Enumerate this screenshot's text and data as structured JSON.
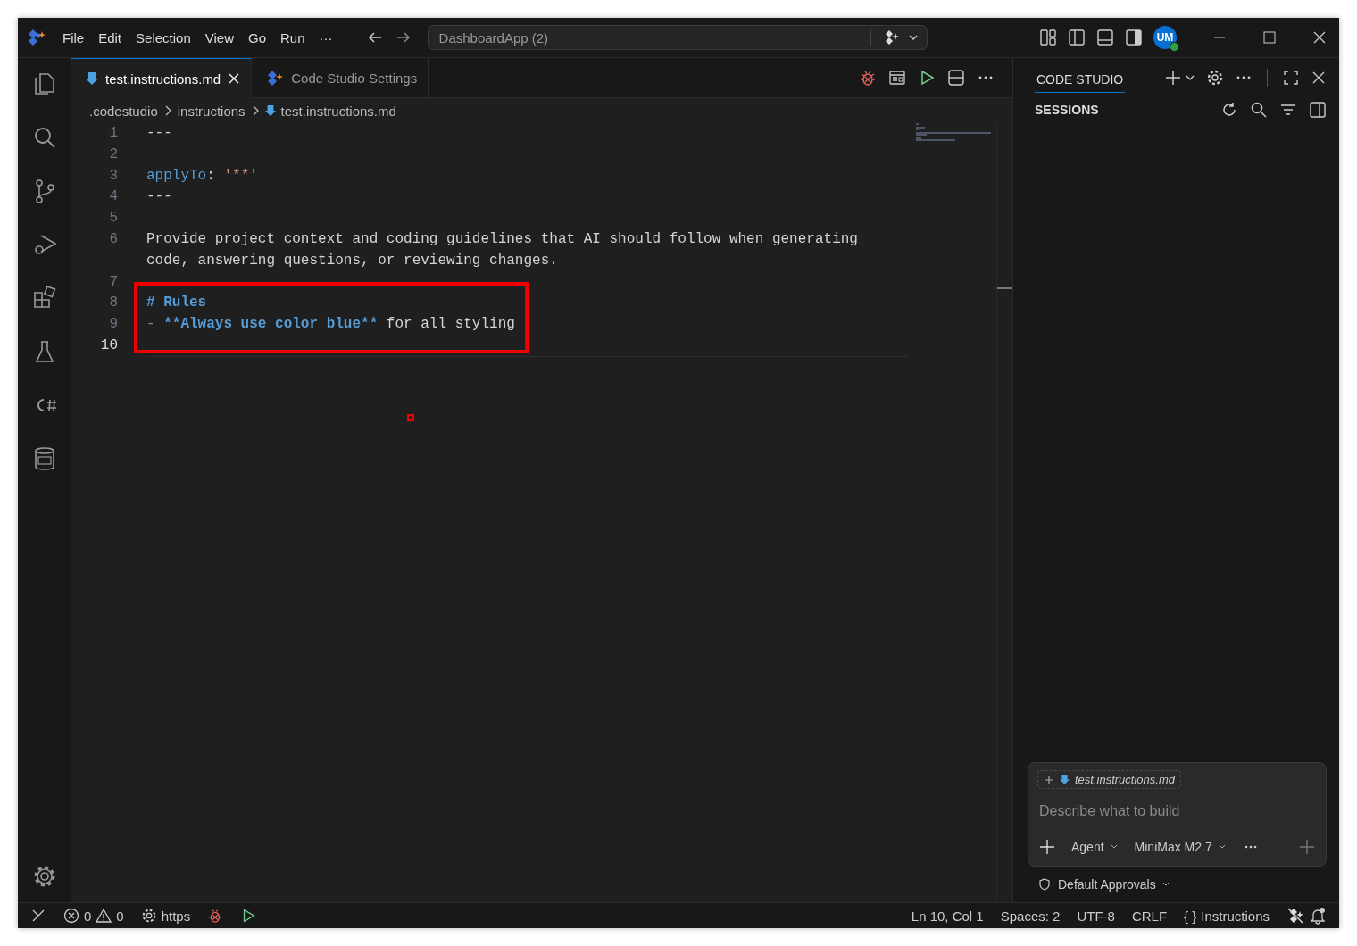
{
  "menu": [
    {
      "label": "File"
    },
    {
      "label": "Edit"
    },
    {
      "label": "Selection"
    },
    {
      "label": "View"
    },
    {
      "label": "Go"
    },
    {
      "label": "Run"
    },
    {
      "label": "···"
    }
  ],
  "command_center": "DashboardApp (2)",
  "avatar": "UM",
  "tabs": [
    {
      "label": "test.instructions.md",
      "selected": true,
      "kind": "markdown"
    },
    {
      "label": "Code Studio Settings",
      "selected": false,
      "kind": "settings"
    }
  ],
  "breadcrumb": [
    ".codestudio",
    "instructions",
    "test.instructions.md"
  ],
  "lines": [
    {
      "number": "1",
      "active": false,
      "tokens": [
        {
          "kind": "plain",
          "text": "---"
        }
      ]
    },
    {
      "number": "2",
      "active": false
    },
    {
      "number": "3",
      "active": false,
      "tokens": [
        {
          "kind": "key",
          "text": "applyTo"
        },
        {
          "kind": "plain",
          "text": ": "
        },
        {
          "kind": "string",
          "text": "'**'"
        }
      ]
    },
    {
      "number": "4",
      "active": false,
      "tokens": [
        {
          "kind": "plain",
          "text": "---"
        }
      ]
    },
    {
      "number": "5",
      "active": false
    },
    {
      "number": "6",
      "active": false,
      "tokens": [
        {
          "kind": "plain",
          "text": "Provide project context and coding guidelines that AI should follow when generating code, answering questions, or reviewing changes."
        }
      ]
    },
    {
      "number": "7",
      "active": false
    },
    {
      "number": "8",
      "active": false,
      "tokens": [
        {
          "kind": "heading",
          "text": "# Rules"
        }
      ]
    },
    {
      "number": "9",
      "active": false,
      "tokens": [
        {
          "kind": "dim",
          "text": "- "
        },
        {
          "kind": "bold",
          "text": "**Always use color blue**"
        },
        {
          "kind": "plain",
          "text": " for all styling"
        }
      ]
    },
    {
      "number": "10",
      "active": true
    }
  ],
  "panel": {
    "tab": "CODE STUDIO",
    "section": "SESSIONS",
    "attachment": "test.instructions.md",
    "placeholder": "Describe what to build",
    "mode": "Agent",
    "model": "MiniMax M2.7",
    "approvals": "Default Approvals"
  },
  "status_left": {
    "errors": "0",
    "warnings": "0",
    "remote": "https"
  },
  "status_right": [
    {
      "label": "Ln 10, Col 1"
    },
    {
      "label": "Spaces: 2"
    },
    {
      "label": "UTF-8"
    },
    {
      "label": "CRLF"
    },
    {
      "label": "Instructions",
      "prefix": "{ }"
    }
  ]
}
